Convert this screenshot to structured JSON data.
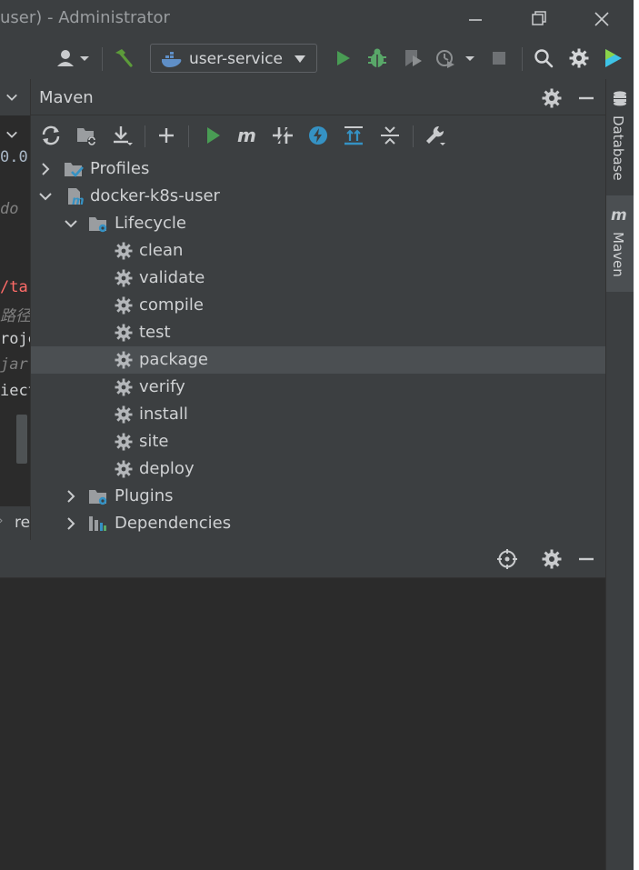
{
  "window": {
    "title": "user) - Administrator"
  },
  "toolbar": {
    "run_config": "user-service"
  },
  "editor": {
    "lines": [
      {
        "text": "0.0",
        "color": "#a9b7c6",
        "italic": false
      },
      {
        "text": "do",
        "color": "#808080",
        "italic": true
      },
      {
        "text": "/tar",
        "color": "#ff6b68",
        "italic": false
      },
      {
        "text": "路径",
        "color": "#808080",
        "italic": true
      },
      {
        "text": "roje",
        "color": "#cfd1d3",
        "italic": false
      },
      {
        "text": "jar",
        "color": "#808080",
        "italic": true
      },
      {
        "text": "iect",
        "color": "#cfd1d3",
        "italic": false
      }
    ],
    "breadcrumb": "re"
  },
  "maven": {
    "title": "Maven",
    "tree": {
      "profiles": "Profiles",
      "project": "docker-k8s-user",
      "lifecycle": "Lifecycle",
      "phases": [
        "clean",
        "validate",
        "compile",
        "test",
        "package",
        "verify",
        "install",
        "site",
        "deploy"
      ],
      "selected_phase": "package",
      "plugins": "Plugins",
      "dependencies": "Dependencies"
    }
  },
  "right_strip": {
    "database": "Database",
    "maven": "Maven"
  },
  "colors": {
    "run_green": "#499c54",
    "debug_green": "#59a869",
    "hammer_green": "#5c9b3a",
    "folder_blue": "#3592c4",
    "accent_blue": "#3592c4"
  }
}
